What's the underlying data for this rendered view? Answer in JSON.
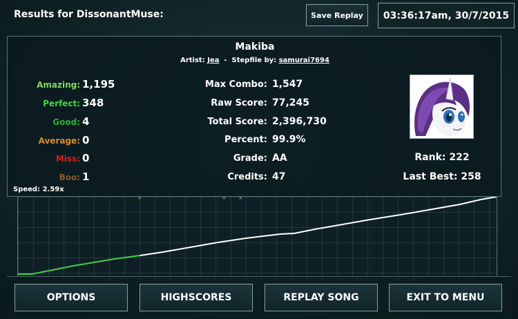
{
  "header": {
    "title": "Results for DissonantMuse:",
    "save_replay_label": "Save Replay",
    "datetime": "03:36:17am, 30/7/2015"
  },
  "song": {
    "title": "Makiba",
    "artist_label": "Artist:",
    "artist": "Jea",
    "separator": "-",
    "stepfile_label": "Stepfile by:",
    "stepfile_author": "samurai7694"
  },
  "judgements": [
    {
      "label": "Amazing:",
      "value": "1,195",
      "color": "#7ed957"
    },
    {
      "label": "Perfect:",
      "value": "348",
      "color": "#43d243"
    },
    {
      "label": "Good:",
      "value": "4",
      "color": "#2eae2e"
    },
    {
      "label": "Average:",
      "value": "0",
      "color": "#e08a1e"
    },
    {
      "label": "Miss:",
      "value": "0",
      "color": "#e01b1b"
    },
    {
      "label": "Boo:",
      "value": "1",
      "color": "#8a5a2a"
    }
  ],
  "stats": [
    {
      "label": "Max Combo:",
      "value": "1,547"
    },
    {
      "label": "Raw Score:",
      "value": "77,245"
    },
    {
      "label": "Total Score:",
      "value": "2,396,730"
    },
    {
      "label": "Percent:",
      "value": "99.9%"
    },
    {
      "label": "Grade:",
      "value": "AA"
    },
    {
      "label": "Credits:",
      "value": "47"
    }
  ],
  "player": {
    "avatar_icon": "pony-avatar-icon",
    "rank": "Rank: 222",
    "last_best": "Last Best: 258"
  },
  "speed": "Speed: 2.59x",
  "graph": {
    "line_color_start": "#43d243",
    "line_color_rest": "#ffffff",
    "marker_color": "#43d243"
  },
  "buttons": {
    "options": "OPTIONS",
    "highscores": "HIGHSCORES",
    "replay_song": "REPLAY SONG",
    "exit_to_menu": "EXIT TO MENU"
  }
}
